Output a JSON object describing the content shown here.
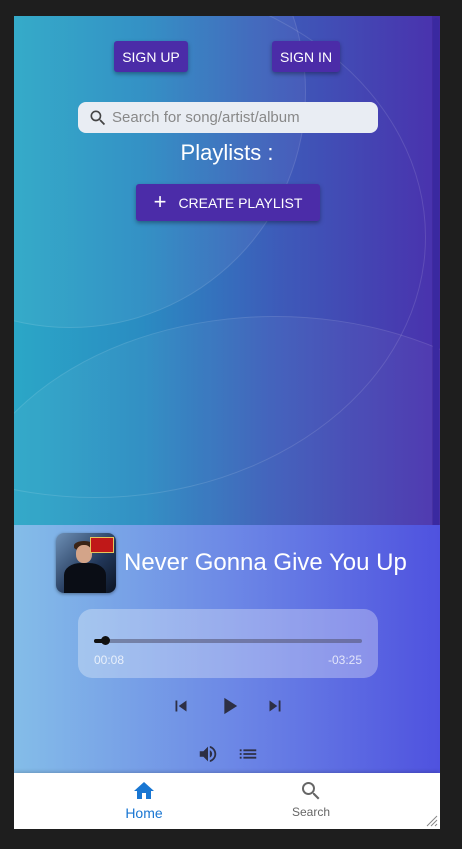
{
  "auth": {
    "signup_label": "SIGN UP",
    "signin_label": "SIGN IN"
  },
  "search": {
    "placeholder": "Search for song/artist/album",
    "icon": "search-icon"
  },
  "playlists": {
    "heading": "Playlists :",
    "create_label": "CREATE PLAYLIST",
    "create_icon": "plus-icon"
  },
  "player": {
    "title": "Never Gonna Give You Up",
    "current_time": "00:08",
    "remaining_time": "-03:25",
    "progress_fraction": 0.04,
    "controls": [
      "skip-previous-icon",
      "play-icon",
      "skip-next-icon",
      "volume-icon",
      "queue-icon"
    ]
  },
  "nav": {
    "home_label": "Home",
    "search_label": "Search",
    "active": "Home",
    "active_color": "#1976d2"
  },
  "colors": {
    "button": "#4b2ca8",
    "accent": "#1976d2"
  }
}
